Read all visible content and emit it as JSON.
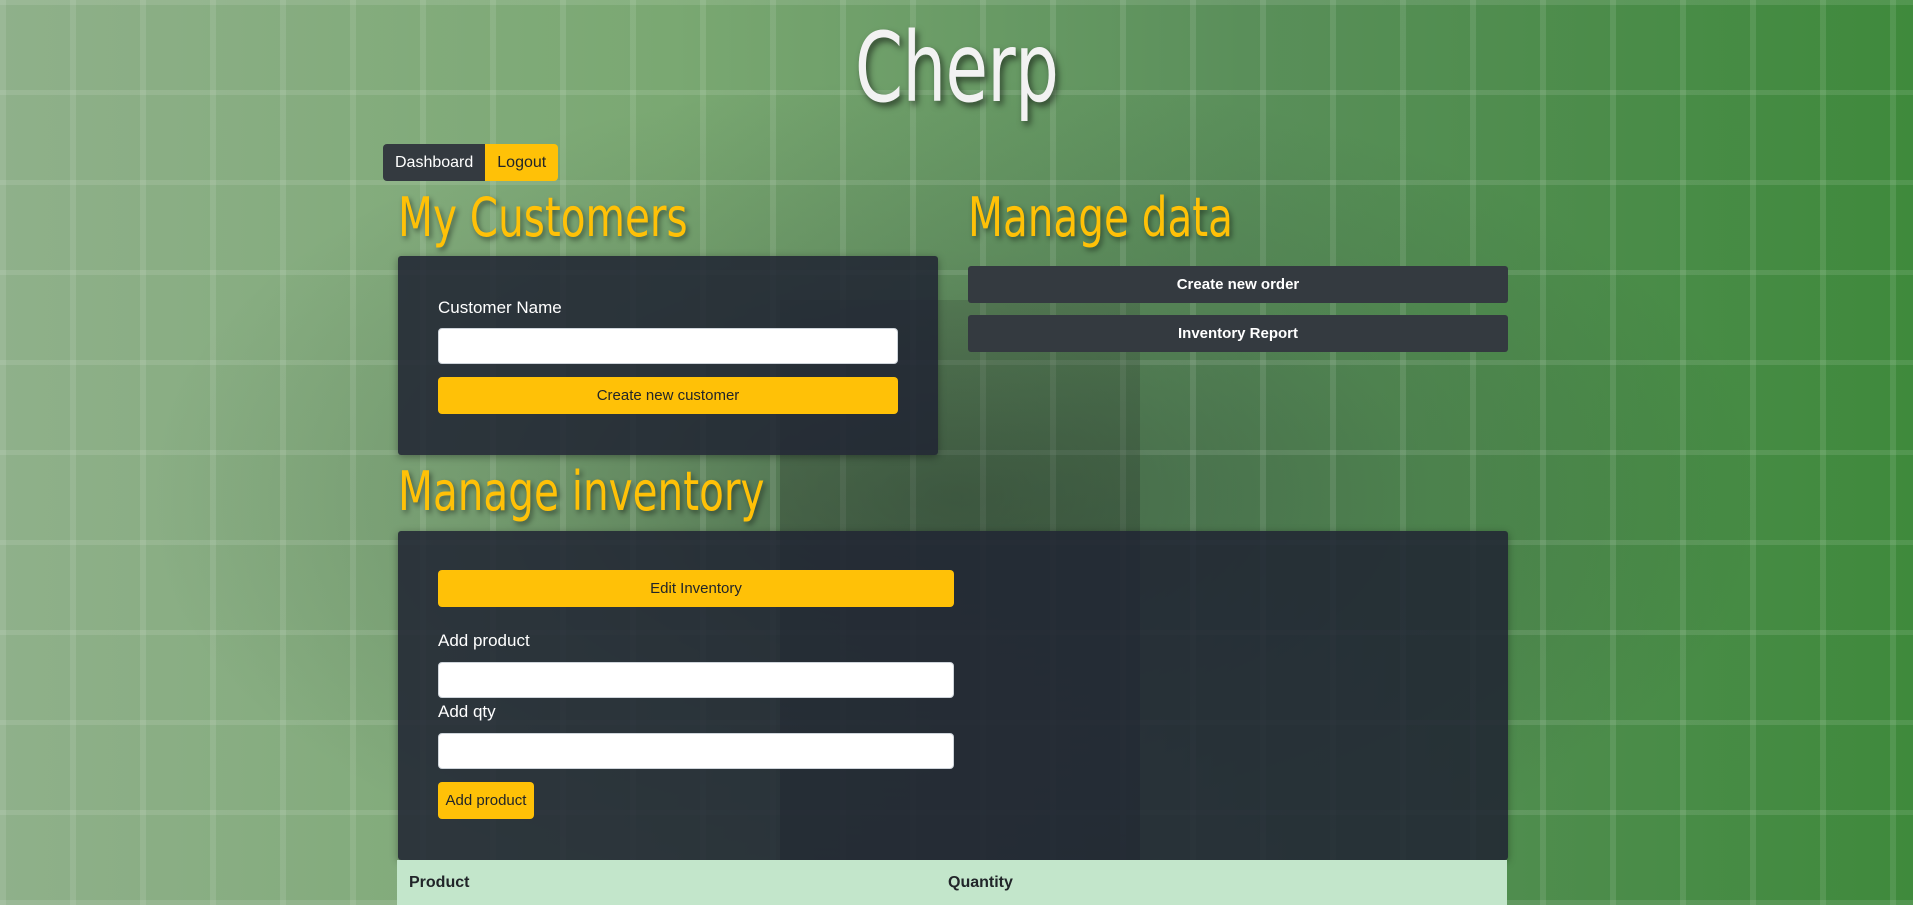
{
  "app": {
    "title": "Cherp"
  },
  "nav": {
    "dashboard_label": "Dashboard",
    "logout_label": "Logout"
  },
  "customers": {
    "heading": "My Customers",
    "name_label": "Customer Name",
    "name_value": "",
    "create_button": "Create new customer"
  },
  "manage_data": {
    "heading": "Manage data",
    "create_order_button": "Create new order",
    "inventory_report_button": "Inventory Report"
  },
  "inventory": {
    "heading": "Manage inventory",
    "edit_button": "Edit Inventory",
    "product_label": "Add product",
    "product_value": "",
    "qty_label": "Add qty",
    "qty_value": "",
    "add_button": "Add product",
    "table_headers": [
      "Product",
      "Quantity"
    ]
  },
  "colors": {
    "accent": "#ffc107",
    "dark": "#343a40",
    "panel": "#212533",
    "table_header": "#c3e6cb"
  }
}
